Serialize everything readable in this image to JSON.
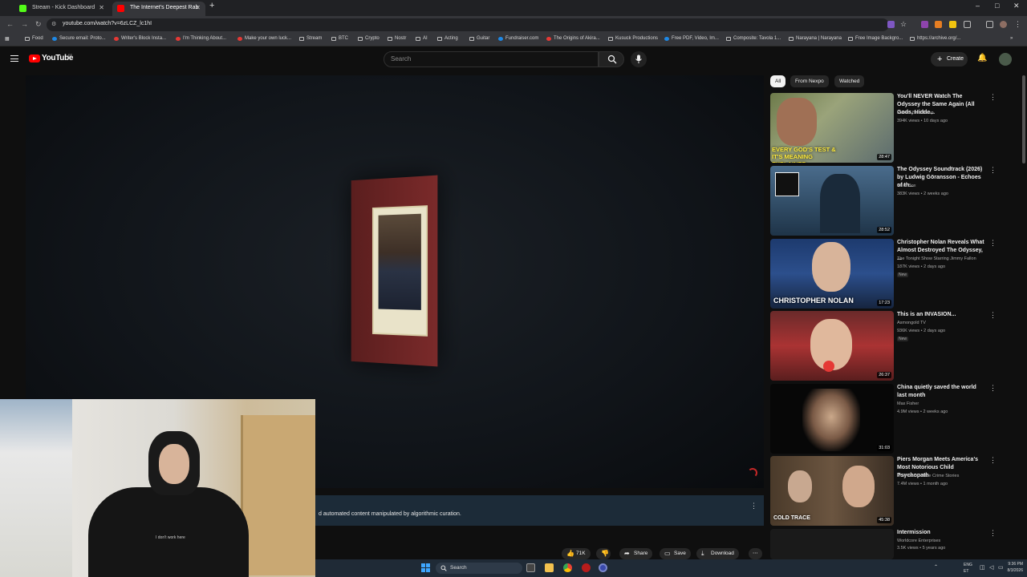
{
  "browser": {
    "tabs": [
      {
        "title": "Stream - Kick Dashboard",
        "favicon_color": "#53fc18"
      },
      {
        "title": "The Internet's Deepest Rab",
        "favicon_color": "#ff0000"
      }
    ],
    "url": "youtube.com/watch?v=6zLCZ_lc1hI",
    "window_controls": {
      "minimize": "–",
      "maximize": "□",
      "close": "✕"
    },
    "bookmarks": [
      {
        "label": "Food",
        "icon": "folder-icon"
      },
      {
        "label": "Secure email: Proto...",
        "icon": "protonmail-icon"
      },
      {
        "label": "Writer's Block Insta...",
        "icon": "youtube-icon"
      },
      {
        "label": "I'm Thinking About...",
        "icon": "youtube-icon"
      },
      {
        "label": "Make your own luck...",
        "icon": "youtube-icon"
      },
      {
        "label": "Stream",
        "icon": "folder-icon"
      },
      {
        "label": "BTC",
        "icon": "folder-icon"
      },
      {
        "label": "Crypto",
        "icon": "folder-icon"
      },
      {
        "label": "Nostr",
        "icon": "folder-icon"
      },
      {
        "label": "AI",
        "icon": "folder-icon"
      },
      {
        "label": "Acting",
        "icon": "folder-icon"
      },
      {
        "label": "Guitar",
        "icon": "folder-icon"
      },
      {
        "label": "Fundraiser.com",
        "icon": "globe-icon"
      },
      {
        "label": "The Origins of Akira...",
        "icon": "youtube-icon"
      },
      {
        "label": "Kusuck Productions",
        "icon": "folder-icon"
      },
      {
        "label": "Free PDF, Video, Im...",
        "icon": "globe-icon"
      },
      {
        "label": "Composite: Tavola 1...",
        "icon": "grid-icon"
      },
      {
        "label": "Narayana | Narayana",
        "icon": "page-icon"
      },
      {
        "label": "Free Image Backgro...",
        "icon": "page-icon"
      },
      {
        "label": "https://archive.org/...",
        "icon": "page-icon"
      }
    ]
  },
  "youtube": {
    "logo_text": "YouTube",
    "country_code": "EE",
    "search_placeholder": "Search",
    "create_label": "Create",
    "accent": "#ff0000"
  },
  "video": {
    "banner_text": "d automated content manipulated by algorithmic curation.",
    "hoodie_text": "I don't work here"
  },
  "actions": [
    {
      "label": "71K",
      "icon": "like-icon"
    },
    {
      "label": "",
      "icon": "dislike-icon"
    },
    {
      "label": "Share",
      "icon": "share-icon"
    },
    {
      "label": "Save",
      "icon": "save-icon"
    },
    {
      "label": "Download",
      "icon": "download-icon"
    }
  ],
  "sidebar": {
    "chips": [
      "All",
      "From Nexpo",
      "Watched"
    ],
    "recommendations": [
      {
        "title": "You'll NEVER Watch The Odyssey the Same Again (All Gods, Hidde...",
        "channel": "Movies Balls Deep",
        "meta": "394K views • 10 days ago",
        "duration": "28:47",
        "new": "",
        "overlay": "EVERY GOD'S TEST & IT'S MEANING EXPLAINED"
      },
      {
        "title": "The Odyssey Soundtrack (2026) by Ludwig Göransson - Echoes of th...",
        "channel": "Kaka Box",
        "meta": "383K views • 2 weeks ago",
        "duration": "28:52",
        "new": "",
        "overlay": ""
      },
      {
        "title": "Christopher Nolan Reveals What Almost Destroyed The Odyssey, ...",
        "channel": "The Tonight Show Starring Jimmy Fallon",
        "meta": "187K views • 2 days ago",
        "duration": "17:23",
        "new": "New",
        "overlay": "CHRISTOPHER NOLAN"
      },
      {
        "title": "This is an INVASION...",
        "channel": "Asmongold TV",
        "meta": "936K views • 2 days ago",
        "duration": "26:37",
        "new": "New",
        "overlay": ""
      },
      {
        "title": "China quietly saved the world last month",
        "channel": "Max Fisher",
        "meta": "4.9M views • 2 weeks ago",
        "duration": "31:03",
        "new": "",
        "overlay": ""
      },
      {
        "title": "Piers Morgan Meets America's Most Notorious Child Psychopath",
        "channel": "Cold Trace - True Crime Stories",
        "meta": "7.4M views • 1 month ago",
        "duration": "45:38",
        "new": "",
        "overlay": "COLD TRACE"
      },
      {
        "title": "Intermission",
        "channel": "Worldcore Enterprises",
        "meta": "3.5K views • 5 years ago",
        "duration": "",
        "new": "",
        "overlay": ""
      }
    ]
  },
  "taskbar": {
    "search_label": "Search",
    "lang": "ENG",
    "lang_sub": "ET",
    "time": "9:36 PM",
    "date": "8/3/2026"
  }
}
